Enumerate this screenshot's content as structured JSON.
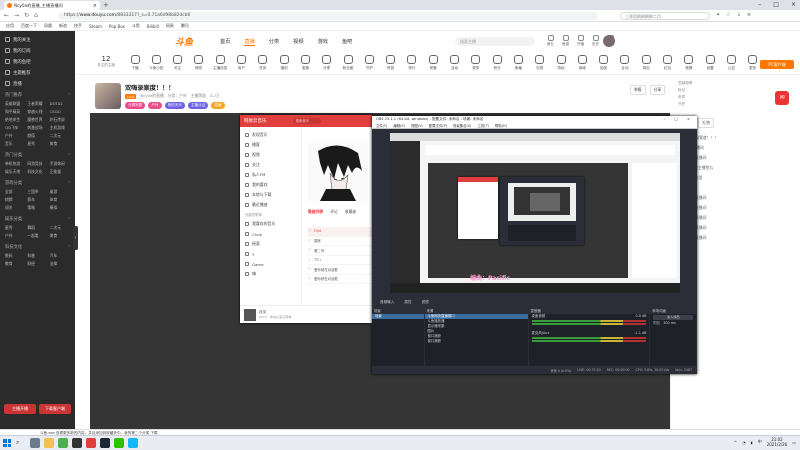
{
  "browser": {
    "tab_title": "Ncy0e的直播_主播直播间",
    "url_prefix": "https://",
    "url_domain": "www.douyu.com",
    "url_path": "/8833317?_s=0.71a6d98b82dcb6",
    "search_placeholder": "三季稻刷刷刷刷二月",
    "bookmarks": [
      "应用",
      "百度一下",
      "凤凰",
      "新浪",
      "快手",
      "Steam",
      "Pop Box",
      "斗鱼",
      "Bilibili",
      "网易",
      "腾讯"
    ]
  },
  "site": {
    "logo": "斗鱼",
    "nav_tabs": [
      "首页",
      "直播",
      "分类",
      "视频",
      "游戏",
      "鱼吧"
    ],
    "active_tab": "直播",
    "search_placeholder": "搜索主播",
    "user_icons": [
      "鱼丸",
      "鱼翅",
      "开播",
      "历史",
      "消息"
    ],
    "categories": [
      "下播",
      "斗鱼小贴",
      "关注",
      "精彩",
      "主播信息",
      "用户",
      "任务",
      "福利",
      "宝箱",
      "分享",
      "粉丝团",
      "守护",
      "贵族",
      "排行",
      "房管",
      "活动",
      "更多",
      "积分",
      "鱼塘",
      "礼物",
      "特权",
      "商城",
      "抽奖",
      "互动",
      "背包",
      "红包",
      "竞猜",
      "设置",
      "公告",
      "更多"
    ],
    "cat_count": "12",
    "cat_count_label": "关注的主播",
    "pc_button": "PC客户端"
  },
  "room": {
    "title": "双嗨录案度！！！",
    "level": "LV.8",
    "meta": [
      "Ncy0e的直播",
      "分类：户外",
      "主播等级",
      "3.2万"
    ],
    "badges": [
      "元宵祝愿",
      "户外",
      "夜的天乐",
      "主播认证",
      "高速"
    ],
    "badge_colors": [
      "#e84a8a",
      "#e84a8a",
      "#6b63e6",
      "#6b63e6",
      "#f5a623"
    ],
    "actions": [
      "举报",
      "分享"
    ],
    "rank_panel": [
      "贡献周榜",
      "粉丝",
      "贵宾",
      "守护"
    ]
  },
  "sidebar": {
    "items": [
      "我的关注",
      "我的订阅",
      "我的鱼吧",
      "主题推荐",
      "直播"
    ],
    "section1": "热门推荐",
    "grid1": [
      "英雄联盟",
      "王者荣耀",
      "DOTA2",
      "和平精英",
      "穿越火线",
      "CSGO",
      "绝地求生",
      "魔兽世界",
      "炉石传说",
      "QQ飞车",
      "刺激战场",
      "主机游戏",
      "户外",
      "颜值",
      "二次元",
      "音乐",
      "星秀",
      "美食"
    ],
    "section2": "热门分类",
    "grid2": [
      "单机热游",
      "网游竞技",
      "手游休闲",
      "娱乐天地",
      "科技文化",
      "正能量"
    ],
    "section3": "游戏分类",
    "grid3": [
      "全部",
      "三国杀",
      "桌游",
      "棋牌",
      "赛车",
      "体育",
      "闯关",
      "策略",
      "模拟"
    ],
    "section4": "娱乐分类",
    "grid4": [
      "星秀",
      "舞蹈",
      "二次元",
      "户外",
      "一起看",
      "美食"
    ],
    "section5": "科技文化",
    "grid5": [
      "数码",
      "科普",
      "汽车",
      "教育",
      "财经",
      "法律"
    ],
    "buttons": [
      "主播开播",
      "下载客户端"
    ]
  },
  "music": {
    "app": "网易云音乐",
    "search": "搜索音乐",
    "menu": [
      "发现音乐",
      "播客",
      "视频",
      "关注",
      "私人FM",
      "我的喜欢",
      "本地与下载",
      "最近播放"
    ],
    "section": "创建的歌单",
    "playlists": [
      "我喜欢的音乐",
      "Chuk",
      "摇滚",
      "Y",
      "Game",
      "嗨"
    ],
    "tabs": [
      "歌曲列表",
      "评论",
      "收藏者"
    ],
    "active_tab": "歌曲列表",
    "songs": [
      "First",
      "猫咪",
      "第二号",
      "TT!!",
      "爱你就在对话框",
      "爱你就在对话框"
    ],
    "now_playing": "月见",
    "now_playing_sub": "Ancri · 你的心有点孤单"
  },
  "obs": {
    "title": "OBS 25.1.1 (64-bit, windows) - 配置文件: 未命名 - 场景: 未命名",
    "menu": [
      "文件(F)",
      "编辑(E)",
      "视图(V)",
      "配置文件(P)",
      "场景集合(S)",
      "工具(T)",
      "帮助(H)"
    ],
    "toolbar": [
      "音频输入",
      "属性",
      "滤镜"
    ],
    "docks": [
      "场景",
      "来源",
      "混音器",
      "转场动画",
      "控制"
    ],
    "scene": "场景",
    "sources": [
      "斗鱼网页直播窗口",
      "斗鱼播放器",
      "显示器采集",
      "图片",
      "窗口捕获",
      "窗口捕获"
    ],
    "mixer": [
      "桌面音频",
      "麦克风/Aux"
    ],
    "mixer_db": [
      "0.0 dB",
      "-1.1 dB"
    ],
    "transition": "淡入淡出",
    "duration_label": "时长",
    "duration": "300 ms",
    "controls": [
      "停止直播",
      "开始录制",
      "工作室模式",
      "设置",
      "退出"
    ],
    "status": [
      "丢帧 0 (0.0%)",
      "LIVE: 00:37:20",
      "REC: 00:00:00",
      "CPU: 5.8%, 30.00 fps",
      "kb/s: 2487"
    ]
  },
  "video": {
    "lyric": "编曲：Pacific"
  },
  "chat": {
    "tabs": [
      "弹幕",
      "礼物"
    ],
    "active_tab": "弹幕",
    "messages": [
      "[主播] 双嗨录案度！！！",
      "鱼丸 进入直播间",
      "欢迎来到本直播间",
      "Ncy0e: 送给主播鱼丸",
      "歌单在群公告里",
      "好听好听",
      "欢迎来到本直播间",
      "欢迎来到本直播间",
      "欢迎来到本直播间",
      "欢迎来到本直播间",
      "欢迎来到本直播间"
    ]
  },
  "download_bar": "斗鱼.exe  查看更多新的内容，并且添加到收藏夹中，我的第二个分类 下载",
  "taskbar": {
    "time": "21:02",
    "date": "2021/2/26",
    "lang": "中"
  }
}
